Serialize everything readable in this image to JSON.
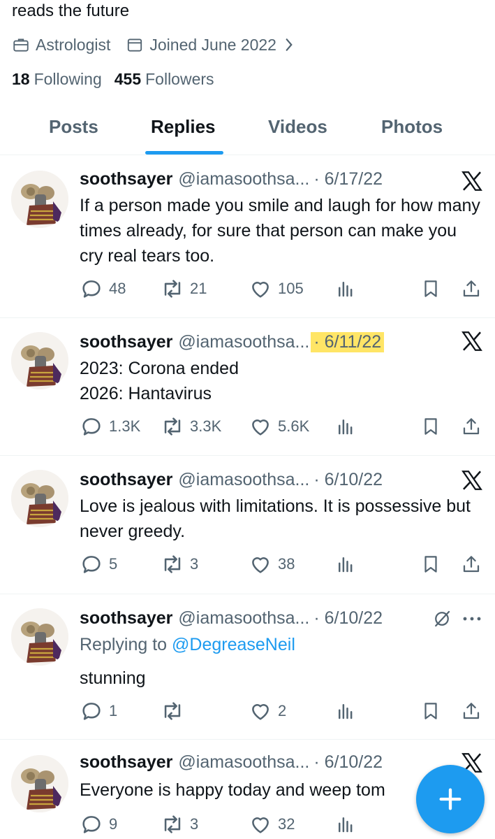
{
  "profile": {
    "bio": "reads the future",
    "category": "Astrologist",
    "joined": "Joined June 2022",
    "following_count": "18",
    "following_label": "Following",
    "followers_count": "455",
    "followers_label": "Followers"
  },
  "tabs": [
    {
      "label": "Posts",
      "active": false
    },
    {
      "label": "Replies",
      "active": true
    },
    {
      "label": "Videos",
      "active": false
    },
    {
      "label": "Photos",
      "active": false
    }
  ],
  "tweets": [
    {
      "name": "soothsayer",
      "handle": "@iamasoothsa...",
      "date": "· 6/17/22",
      "text": "If a person made you smile and laugh for how many times already, for sure that person can make you cry real tears too.",
      "replies": "48",
      "reposts": "21",
      "likes": "105"
    },
    {
      "name": "soothsayer",
      "handle": "@iamasoothsa...",
      "date": "· 6/11/22",
      "text_line1": "2023: Corona ended",
      "text_line2": "2026: Hantavirus",
      "replies": "1.3K",
      "reposts": "3.3K",
      "likes": "5.6K"
    },
    {
      "name": "soothsayer",
      "handle": "@iamasoothsa...",
      "date": "· 6/10/22",
      "text": "Love is jealous with limitations. It is possessive but never greedy.",
      "replies": "5",
      "reposts": "3",
      "likes": "38"
    },
    {
      "name": "soothsayer",
      "handle": "@iamasoothsa...",
      "date": "· 6/10/22",
      "replying_prefix": "Replying to",
      "replying_to": "@DegreaseNeil",
      "text": "stunning",
      "replies": "1",
      "reposts": "",
      "likes": "2"
    },
    {
      "name": "soothsayer",
      "handle": "@iamasoothsa...",
      "date": "· 6/10/22",
      "text": "Everyone is happy today and weep tom",
      "replies": "9",
      "reposts": "3",
      "likes": "32"
    }
  ],
  "colors": {
    "accent": "#1d9bf0",
    "highlight": "#ffe566",
    "secondary_text": "#536471"
  },
  "icons": [
    "briefcase-icon",
    "calendar-icon",
    "chevron-right-icon",
    "x-logo-icon",
    "reply-icon",
    "repost-icon",
    "like-icon",
    "views-icon",
    "bookmark-icon",
    "share-icon",
    "muted-icon",
    "more-icon",
    "plus-icon"
  ]
}
